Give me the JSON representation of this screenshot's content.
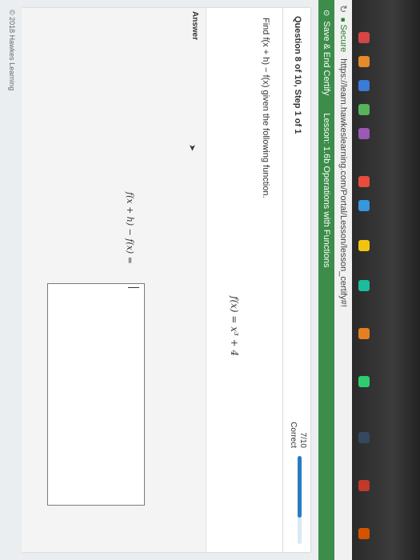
{
  "browser": {
    "secure_label": "Secure",
    "url": "https://learn.hawkeslearning.com/Portal/Lesson/lesson_certify#!"
  },
  "nav": {
    "save_label": "Save & End Certify",
    "lesson_label": "Lesson: 1.6b Operations with Functions"
  },
  "question": {
    "title": "Question 8 of 10, Step 1 of 1",
    "score_fraction": "7/10",
    "score_status": "Correct",
    "progress_fraction": 0.7,
    "prompt": "Find f(x + h) − f(x) given the following function.",
    "function": "f(x) = x³ + 4"
  },
  "answer": {
    "label": "Answer",
    "expression_lhs": "f(x + h) − f(x) =",
    "input_value": ""
  },
  "footer": {
    "copyright": "© 2018 Hawkes Learning"
  },
  "colors": {
    "nav_green": "#3c8d4a",
    "progress_blue": "#2c7bc0"
  }
}
